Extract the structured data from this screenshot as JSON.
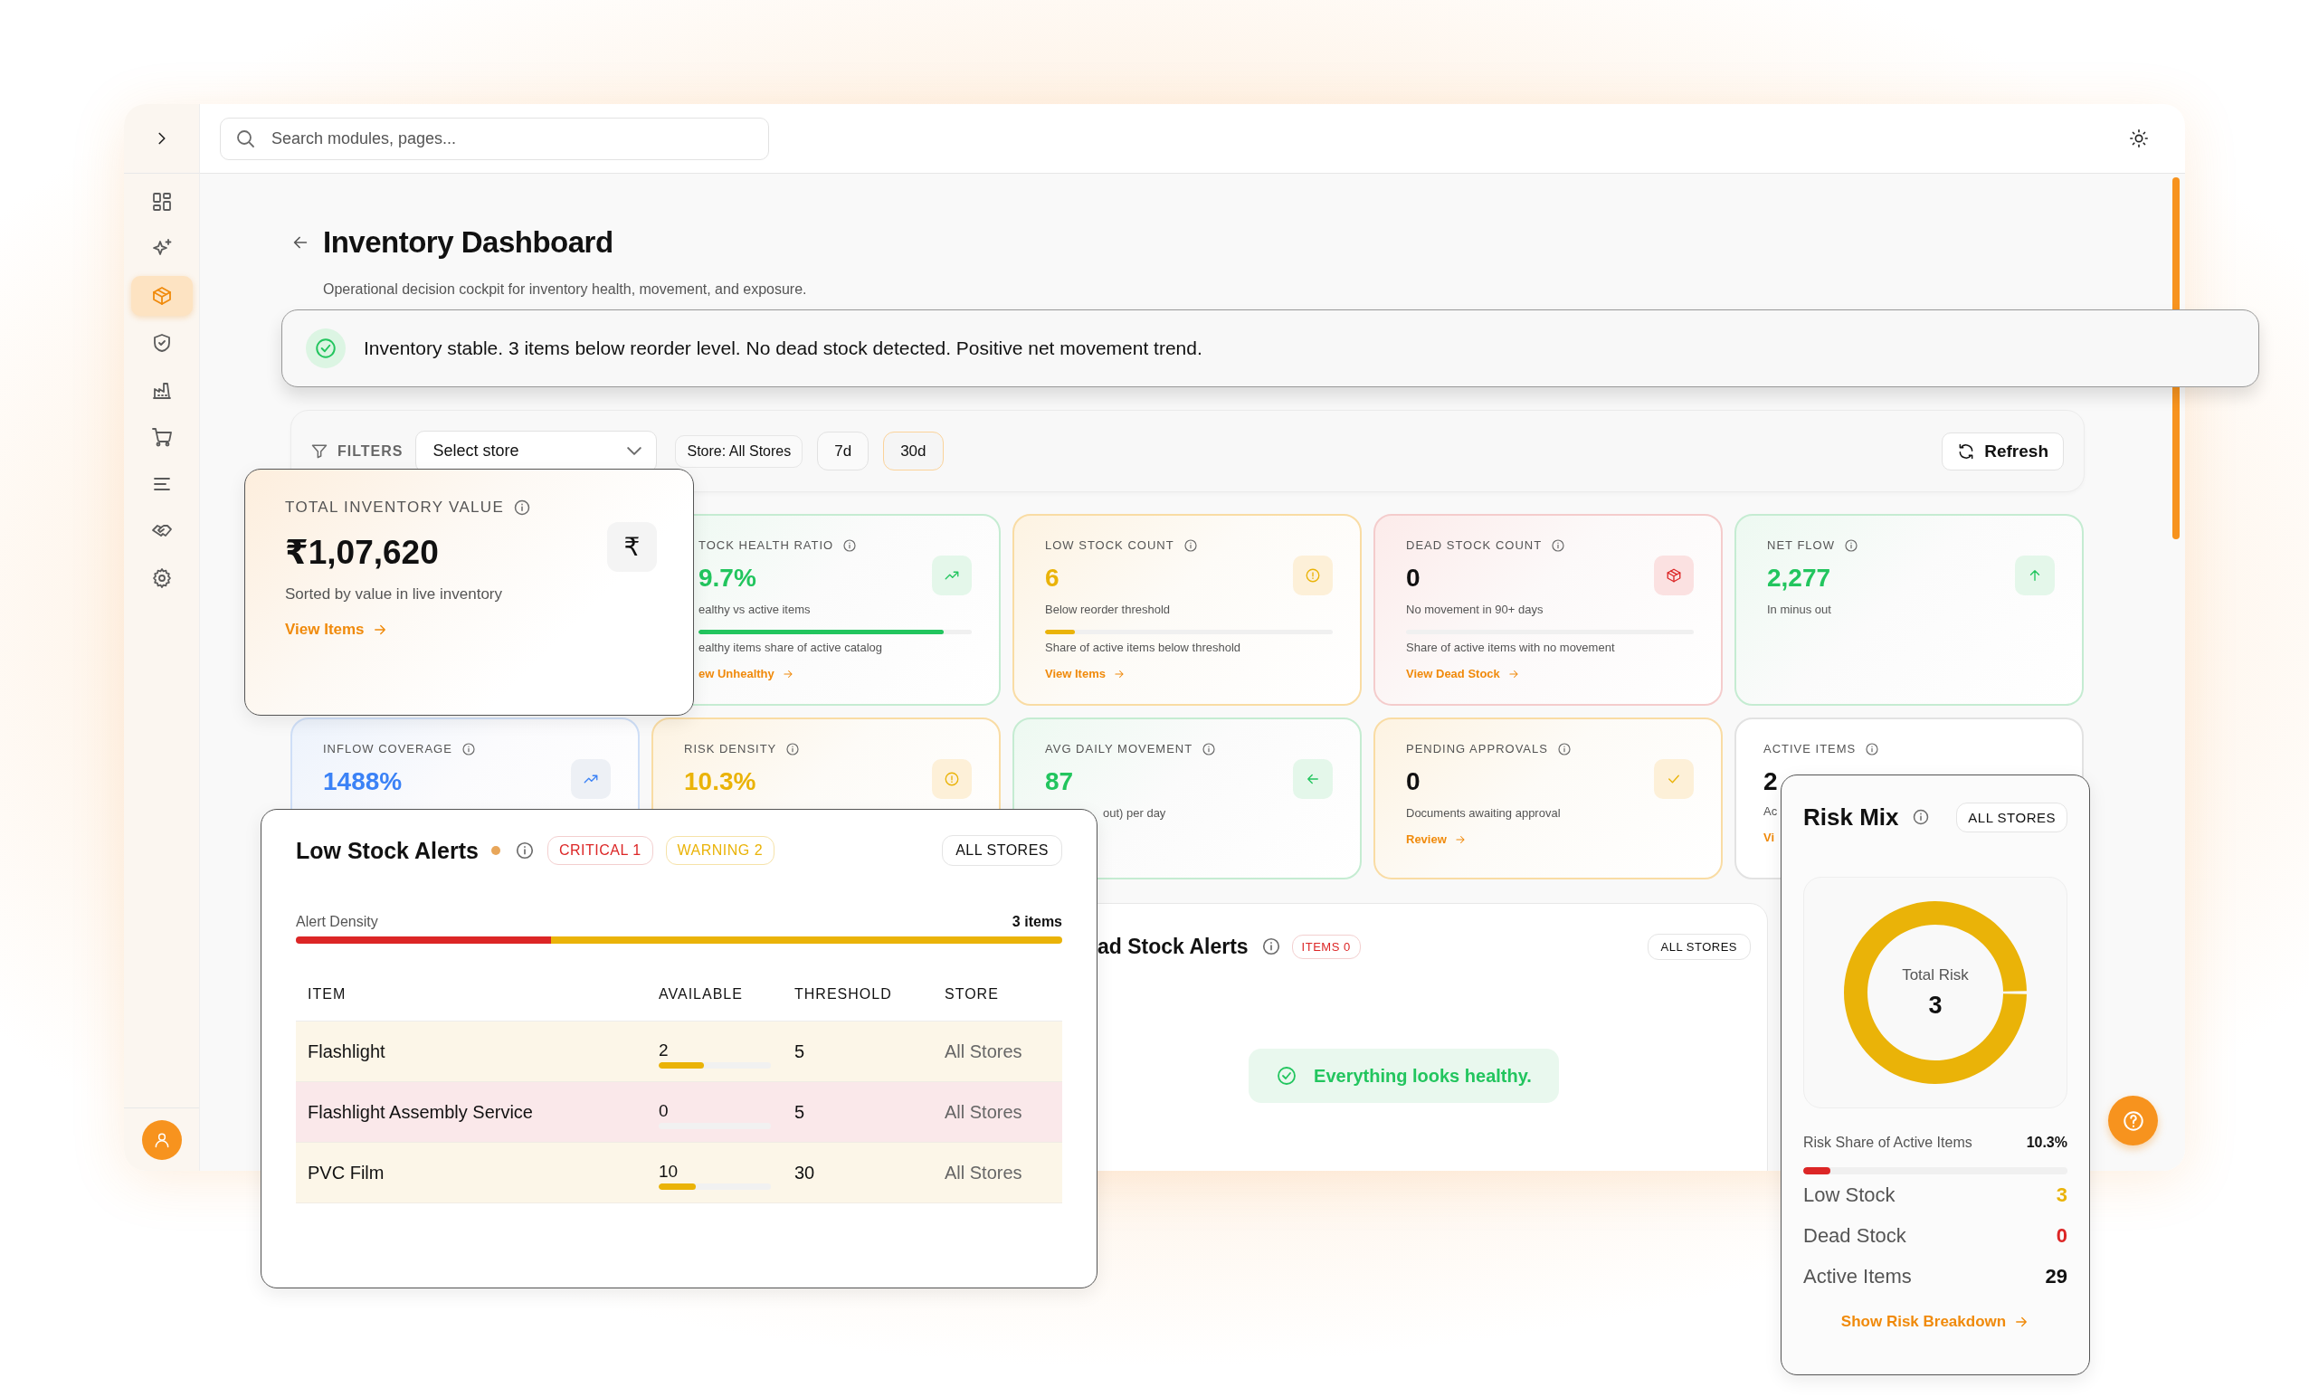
{
  "search": {
    "placeholder": "Search modules, pages..."
  },
  "sidebar": {
    "items": [
      {
        "selected": false
      },
      {
        "selected": false
      },
      {
        "selected": true
      },
      {
        "selected": false
      },
      {
        "selected": false
      },
      {
        "selected": false
      },
      {
        "selected": false
      },
      {
        "selected": false
      },
      {
        "selected": false
      }
    ]
  },
  "page": {
    "title": "Inventory Dashboard",
    "subtitle": "Operational decision cockpit for inventory health, movement, and exposure."
  },
  "banner": {
    "text": "Inventory stable. 3 items below reorder level. No dead stock detected. Positive net movement trend."
  },
  "filters": {
    "label": "FILTERS",
    "store_select": {
      "value": "Select store"
    },
    "store_chip": "Store: All Stores",
    "periods": [
      {
        "label": "7d",
        "selected": false
      },
      {
        "label": "30d",
        "selected": true
      }
    ],
    "refresh": "Refresh"
  },
  "metric_cards": [
    {
      "label": "TOCK HEALTH RATIO",
      "value": "9.7%",
      "subtitle": "ealthy vs active items",
      "level": 0.897,
      "note": "ealthy items share of active catalog",
      "link": "ew Unhealthy",
      "kind": "green",
      "color": "#22c55e"
    },
    {
      "label": "LOW STOCK COUNT",
      "value": "6",
      "subtitle": "Below reorder threshold",
      "level": 0.103,
      "note": "Share of active items below threshold",
      "link": "View Items",
      "kind": "amber",
      "color": "#eab308"
    },
    {
      "label": "DEAD STOCK COUNT",
      "value": "0",
      "subtitle": "No movement in 90+ days",
      "level": 0,
      "note": "Share of active items with no movement",
      "link": "View Dead Stock",
      "kind": "red",
      "color": "#111111"
    },
    {
      "label": "NET FLOW",
      "value": "2,277",
      "subtitle": "In minus out",
      "kind": "green",
      "color": "#22c55e"
    },
    {
      "label": "INFLOW COVERAGE",
      "value": "1488%",
      "kind": "blue",
      "color": "#3b82f6"
    },
    {
      "label": "RISK DENSITY",
      "value": "10.3%",
      "kind": "amber",
      "color": "#eab308"
    },
    {
      "label": "AVG DAILY MOVEMENT",
      "value": "87",
      "subtitle": "out) per day",
      "kind": "green",
      "color": "#22c55e"
    },
    {
      "label": "PENDING APPROVALS",
      "value": "0",
      "subtitle": "Documents awaiting approval",
      "link": "Review",
      "kind": "amber",
      "color": "#111111"
    },
    {
      "label": "ACTIVE ITEMS",
      "value": "2",
      "subtitle": "Ac",
      "link": "Vi",
      "kind": "gray",
      "color": "#111111"
    }
  ],
  "dead_stock": {
    "title": "ad Stock Alerts",
    "badge": "ITEMS 0",
    "store": "ALL STORES",
    "empty": "Everything looks healthy."
  },
  "total_value": {
    "label": "TOTAL INVENTORY VALUE",
    "value": "₹1,07,620",
    "symbol": "₹",
    "subtitle": "Sorted by value in live inventory",
    "link": "View Items"
  },
  "low_stock": {
    "title": "Low Stock Alerts",
    "badges": [
      {
        "kind": "critical",
        "text": "CRITICAL 1"
      },
      {
        "kind": "warning",
        "text": "WARNING 2"
      }
    ],
    "store": "ALL STORES",
    "density": {
      "label": "Alert Density",
      "count": "3 items",
      "segments": [
        {
          "color": "#dc2626",
          "level": 0.333
        },
        {
          "color": "#eab308",
          "level": 0.667
        }
      ]
    },
    "columns": [
      "ITEM",
      "AVAILABLE",
      "THRESHOLD",
      "STORE"
    ],
    "rows": [
      {
        "item": "Flashlight",
        "available": "2",
        "level": 0.4,
        "threshold": "5",
        "store": "All Stores",
        "kind": "warning"
      },
      {
        "item": "Flashlight Assembly Service",
        "available": "0",
        "level": 0,
        "threshold": "5",
        "store": "All Stores",
        "kind": "critical"
      },
      {
        "item": "PVC Film",
        "available": "10",
        "level": 0.33,
        "threshold": "30",
        "store": "All Stores",
        "kind": "warning"
      }
    ]
  },
  "risk_mix": {
    "title": "Risk Mix",
    "store": "ALL STORES",
    "center_label": "Total Risk",
    "center_value": "3",
    "share_label": "Risk Share of Active Items",
    "share_value": "10.3%",
    "level": 0.103,
    "legend": [
      {
        "label": "Low Stock",
        "value": "3",
        "color": "#eab308"
      },
      {
        "label": "Dead Stock",
        "value": "0",
        "color": "#dc2626"
      },
      {
        "label": "Active Items",
        "value": "29",
        "color": "#111111"
      }
    ],
    "link": "Show Risk Breakdown"
  }
}
